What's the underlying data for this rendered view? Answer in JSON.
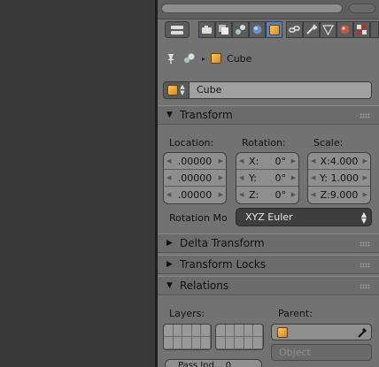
{
  "breadcrumb": {
    "object_name": "Cube"
  },
  "object": {
    "name": "Cube"
  },
  "panels": {
    "transform": {
      "title": "Transform",
      "location": {
        "label": "Location:",
        "x": ".00000",
        "y": ".00000",
        "z": ".00000"
      },
      "rotation": {
        "label": "Rotation:",
        "x_key": "X:",
        "x": "0°",
        "y_key": "Y:",
        "y": "0°",
        "z_key": "Z:",
        "z": "0°"
      },
      "scale": {
        "label": "Scale:",
        "x": "X:4.000",
        "y": "Y: 1.000",
        "z": "Z:9.000"
      },
      "rotation_mode": {
        "label": "Rotation Mo",
        "value": "XYZ Euler"
      }
    },
    "delta_transform": {
      "title": "Delta Transform"
    },
    "transform_locks": {
      "title": "Transform Locks"
    },
    "relations": {
      "title": "Relations",
      "layers_label": "Layers:",
      "parent_label": "Parent:",
      "parent_type": "Object",
      "pass_index_partial": "Pass Ind...     0"
    }
  },
  "colors": {
    "active_tab": "#5680c2",
    "header_bg": "#727272",
    "dark_field": "#3e3e3e"
  }
}
